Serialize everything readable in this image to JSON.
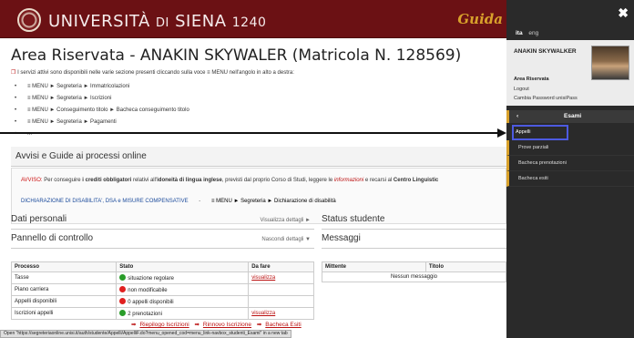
{
  "header": {
    "brand_main": "UNIVERSITÀ",
    "brand_di": "DI",
    "brand_city": "SIENA",
    "brand_year": "1240",
    "guida": "Guida"
  },
  "page": {
    "title": "Area Riservata -  ANAKIN SKYWALER (Matricola N. 128569)",
    "intro": "I servizi attivi sono disponibili nelle varie sezione presenti cliccando sulla voce ≡ MENU nell'angolo in alto a destra:",
    "menu_lines": [
      "≡ MENU ► Segreteria ► Immatricolazioni",
      "≡ MENU ► Segreteria ► Iscrizioni",
      "≡ MENU ► Conseguimento titolo ► Bacheca conseguimento titolo",
      "≡ MENU ► Segreteria ► Pagamenti",
      "..."
    ]
  },
  "avvisi": {
    "section_title": "Avvisi e Guide ai processi online",
    "avviso_label": "AVVISO:",
    "avviso_text_a": " Per conseguire ",
    "avviso_bold1": "i crediti obbligatori",
    "avviso_text_b": " relativi all'",
    "avviso_bold2": "idoneità di lingua inglese",
    "avviso_text_c": ", previsti dal proprio Corso di Studi, leggere le ",
    "avviso_info": "informazioni",
    "avviso_text_d": " e recarsi al ",
    "avviso_bold3": "Centro Linguistic",
    "dsa_link": "DICHIARAZIONE DI DISABILITA', DSA e MISURE COMPENSATIVE",
    "dsa_sep": "-",
    "dsa_path": "≡ MENU ► Segreteria ► Dichiarazione di disabilità"
  },
  "panels": {
    "dati_personali": "Dati personali",
    "dati_action": "Visualizza dettagli ►",
    "status_studente": "Status studente",
    "pannello": "Pannello di controllo",
    "pannello_action": "Nascondi dettagli ▼",
    "messaggi": "Messaggi"
  },
  "control_table": {
    "headers": [
      "Processo",
      "Stato",
      "Da fare"
    ],
    "rows": [
      {
        "processo": "Tasse",
        "stato": "situazione regolare",
        "dot": "green",
        "todo": "visualizza"
      },
      {
        "processo": "Piano carriera",
        "stato": "non modificabile",
        "dot": "red",
        "todo": ""
      },
      {
        "processo": "Appelli disponibili",
        "stato": "0 appelli disponibili",
        "dot": "red",
        "todo": ""
      },
      {
        "processo": "Iscrizioni appelli",
        "stato": "2 prenotazioni",
        "dot": "green",
        "todo": "visualizza"
      }
    ]
  },
  "messages_table": {
    "headers": [
      "Mittente",
      "Titolo"
    ],
    "empty": "Nessun messaggio"
  },
  "quick_links": [
    "Riepilogo Iscrizioni",
    "Rinnovo Iscrizione",
    "Bacheca Esiti"
  ],
  "status_url": "Open \"https://segreteriaonline.unisi.it/auth/studente/Appelli/AppelliF.do?menu_opened_cod=menu_link-navbox_studenti_Esami\" in a new tab",
  "sidebar": {
    "close": "✖",
    "lang_ita": "ita",
    "lang_eng": "eng",
    "user_name": "ANAKIN SKYWALKER",
    "area": "Area Riservata",
    "logout": "Logout",
    "change_password": "Cambia Password unisiPass",
    "nav_back": "‹",
    "nav_title": "Esami",
    "nav_items": [
      "Appelli",
      "Prove parziali",
      "Bacheca prenotazioni",
      "Bacheca esiti"
    ]
  },
  "colors": {
    "header_bg": "#6b1114",
    "accent_gold": "#d8a12b",
    "sidebar_bg": "#2a2a2a",
    "link_red": "#bb1111",
    "selection_blue": "#4d5ae0"
  }
}
